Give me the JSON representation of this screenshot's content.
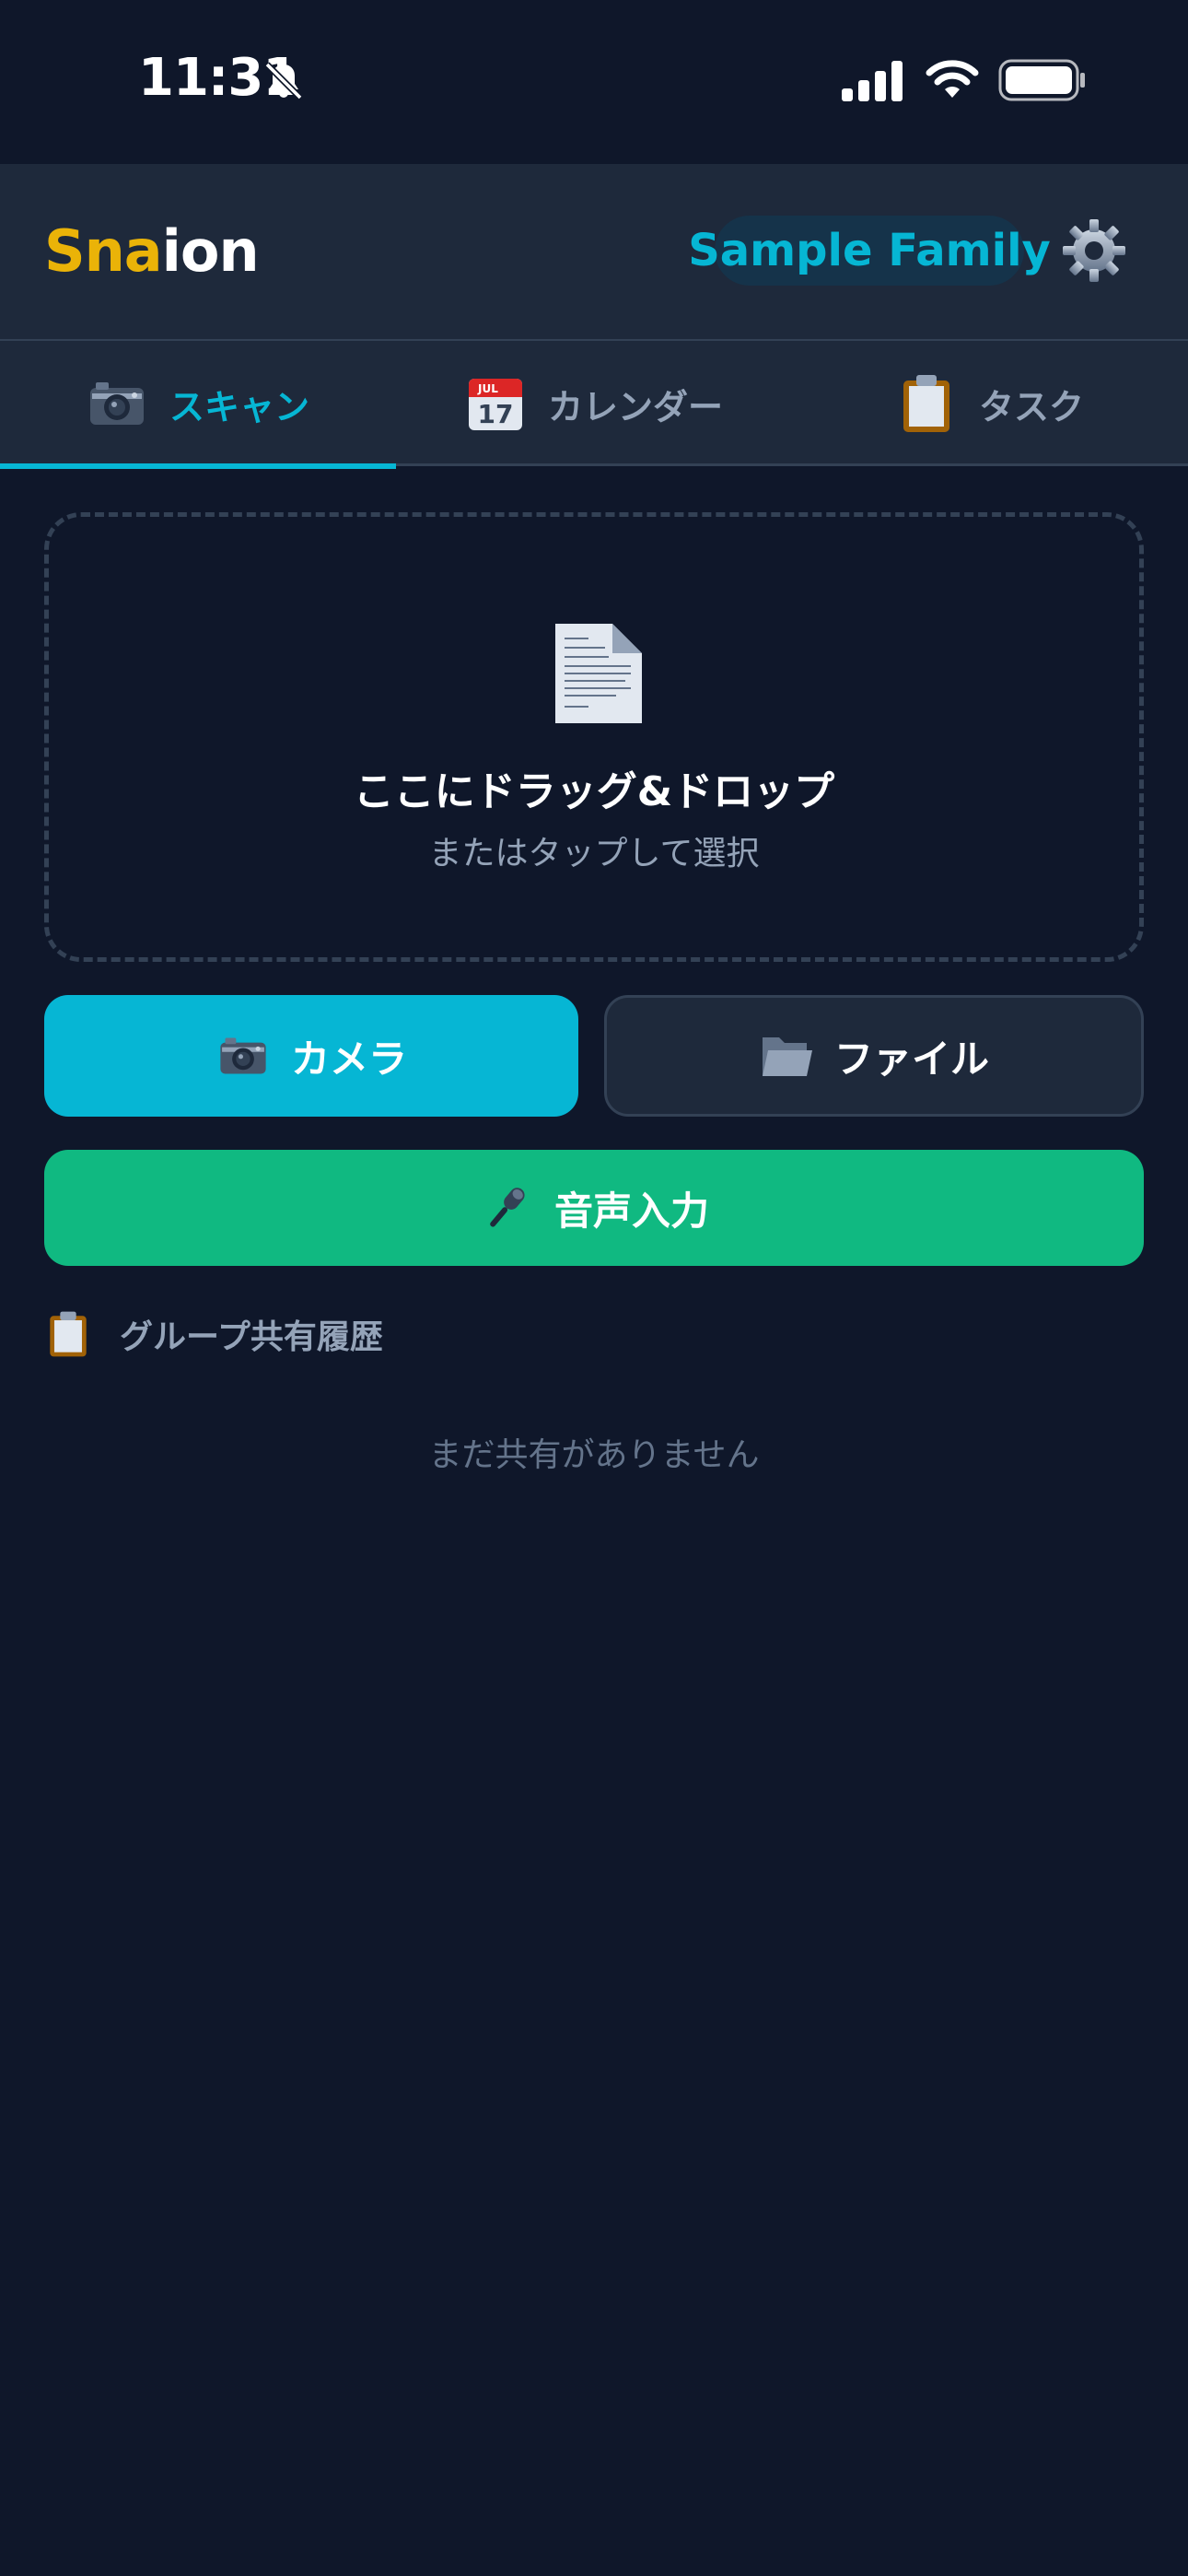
{
  "status_bar": {
    "time": "11:31"
  },
  "header": {
    "logo_part1": "Sna",
    "logo_part2": "ion",
    "family_name": "Sample Family",
    "brand_color": "#eab308",
    "accent_color": "#06b6d4"
  },
  "tabs": [
    {
      "label": "スキャン",
      "icon": "camera-icon",
      "active": true
    },
    {
      "label": "カレンダー",
      "icon": "calendar-icon",
      "active": false
    },
    {
      "label": "タスク",
      "icon": "clipboard-icon",
      "active": false
    }
  ],
  "calendar_icon_text": {
    "month": "JUL",
    "day": "17"
  },
  "dropzone": {
    "icon": "document-icon",
    "title": "ここにドラッグ&ドロップ",
    "subtitle": "またはタップして選択"
  },
  "actions": {
    "camera_label": "カメラ",
    "file_label": "ファイル",
    "voice_label": "音声入力",
    "camera_color": "#06b6d4",
    "voice_color": "#10b981"
  },
  "history": {
    "title": "グループ共有履歴",
    "empty_text": "まだ共有がありません"
  }
}
